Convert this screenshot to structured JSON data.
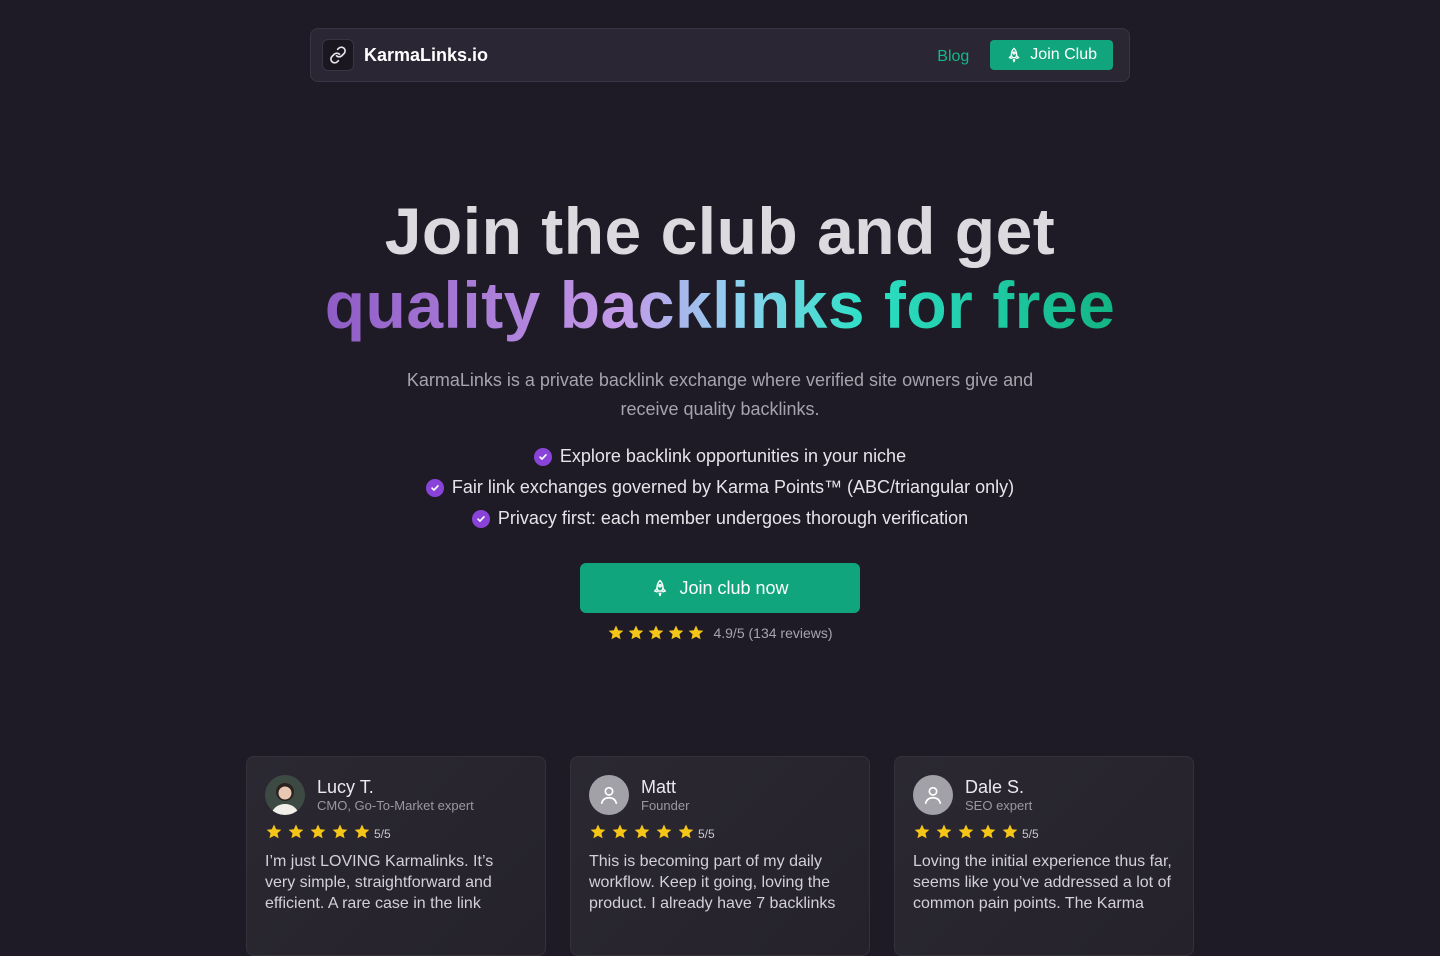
{
  "nav": {
    "brand": "KarmaLinks.io",
    "blog_label": "Blog",
    "join_label": "Join Club"
  },
  "hero": {
    "title_line1": "Join the club and get",
    "title_line2": "quality backlinks for free",
    "subtitle": "KarmaLinks is a private backlink exchange where verified site owners give and receive quality backlinks.",
    "features": [
      "Explore backlink opportunities in your niche",
      "Fair link exchanges governed by Karma Points™ (ABC/triangular only)",
      "Privacy first: each member undergoes thorough verification"
    ],
    "cta_label": "Join club now",
    "rating_text": "4.9/5 (134 reviews)",
    "rating_stars": 5
  },
  "testimonials": [
    {
      "name": "Lucy T.",
      "role": "CMO, Go-To-Market expert",
      "score": "5/5",
      "stars": 5,
      "quote": "I’m just LOVING Karmalinks. It’s very simple, straightforward and efficient. A rare case in the link"
    },
    {
      "name": "Matt",
      "role": "Founder",
      "score": "5/5",
      "stars": 5,
      "quote": "This is becoming part of my daily workflow. Keep it going, loving the product. I already have 7 backlinks"
    },
    {
      "name": "Dale S.",
      "role": "SEO expert",
      "score": "5/5",
      "stars": 5,
      "quote": "Loving the initial experience thus far, seems like you’ve addressed a lot of common pain points. The Karma"
    }
  ],
  "colors": {
    "accent": "#10a57c",
    "check": "#8a43d8",
    "star": "#f5c518",
    "background": "#1f1b26"
  },
  "icons": {
    "logo": "link-icon",
    "join": "rocket-icon",
    "feature": "check-circle-icon",
    "rating": "star-icon",
    "avatar_default": "user-icon"
  }
}
